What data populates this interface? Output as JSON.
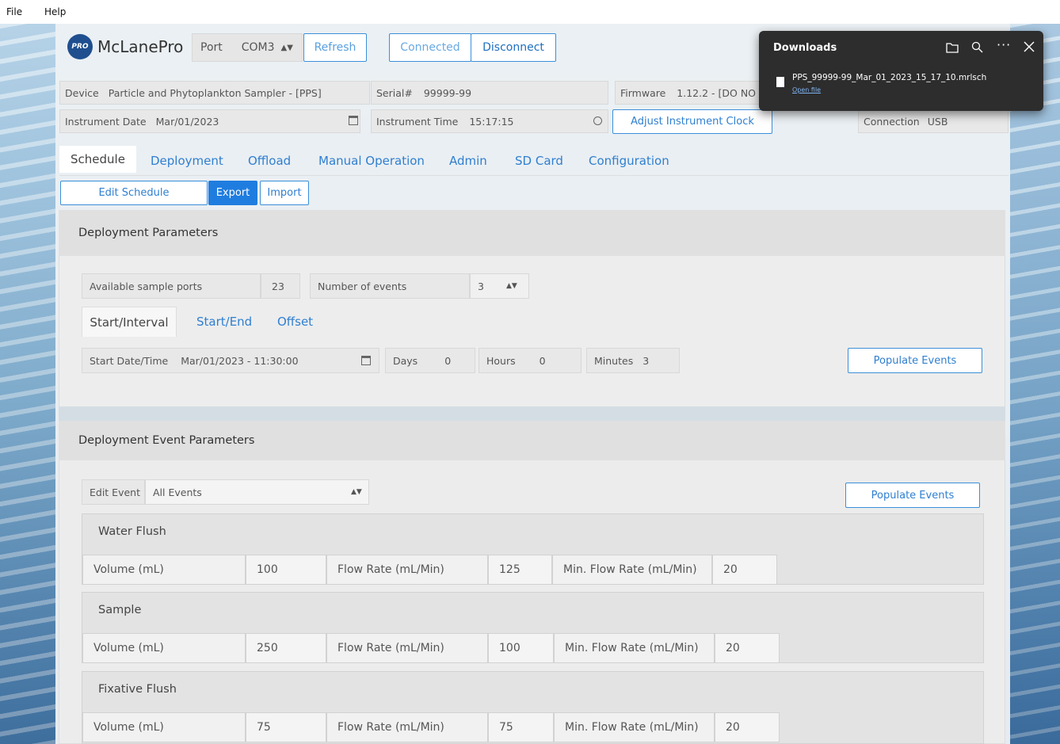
{
  "menu": {
    "file": "File",
    "help": "Help"
  },
  "header": {
    "logo_badge": "PRO",
    "app_name": "McLanePro",
    "port_label": "Port",
    "port_value": "COM3",
    "refresh": "Refresh",
    "connected": "Connected",
    "disconnect": "Disconnect"
  },
  "device": {
    "device_label": "Device",
    "device_value": "Particle and Phytoplankton Sampler - [PPS]",
    "serial_label": "Serial#",
    "serial_value": "99999-99",
    "firmware_label": "Firmware",
    "firmware_value": "1.12.2 - [DO NO",
    "date_label": "Instrument Date",
    "date_value": "Mar/01/2023",
    "time_label": "Instrument Time",
    "time_value": "15:17:15",
    "adjust_clock": "Adjust Instrument Clock",
    "connection_label": "Connection",
    "connection_value": "USB"
  },
  "tabs": [
    "Schedule",
    "Deployment",
    "Offload",
    "Manual Operation",
    "Admin",
    "SD Card",
    "Configuration"
  ],
  "actions": {
    "edit_schedule": "Edit Schedule",
    "export": "Export",
    "import": "Import"
  },
  "deployment": {
    "title": "Deployment Parameters",
    "ports_label": "Available sample ports",
    "ports_value": "23",
    "events_label": "Number of events",
    "events_value": "3",
    "subtabs": [
      "Start/Interval",
      "Start/End",
      "Offset"
    ],
    "start_label": "Start Date/Time",
    "start_value": "Mar/01/2023 - 11:30:00",
    "days_label": "Days",
    "days_value": "0",
    "hours_label": "Hours",
    "hours_value": "0",
    "minutes_label": "Minutes",
    "minutes_value": "3",
    "populate": "Populate Events"
  },
  "event_params": {
    "title": "Deployment Event Parameters",
    "edit_label": "Edit Event",
    "edit_value": "All Events",
    "populate": "Populate Events",
    "groups": [
      {
        "name": "Water Flush",
        "volume_label": "Volume (mL)",
        "volume": "100",
        "flow_label": "Flow Rate (mL/Min)",
        "flow": "125",
        "min_label": "Min. Flow Rate (mL/Min)",
        "min": "20"
      },
      {
        "name": "Sample",
        "volume_label": "Volume (mL)",
        "volume": "250",
        "flow_label": "Flow Rate (mL/Min)",
        "flow": "100",
        "min_label": "Min. Flow Rate (mL/Min)",
        "min": "20"
      },
      {
        "name": "Fixative Flush",
        "volume_label": "Volume (mL)",
        "volume": "75",
        "flow_label": "Flow Rate (mL/Min)",
        "flow": "75",
        "min_label": "Min. Flow Rate (mL/Min)",
        "min": "20"
      }
    ]
  },
  "downloads": {
    "title": "Downloads",
    "file_name": "PPS_99999-99_Mar_01_2023_15_17_10.mrlsch",
    "open_file": "Open file"
  }
}
